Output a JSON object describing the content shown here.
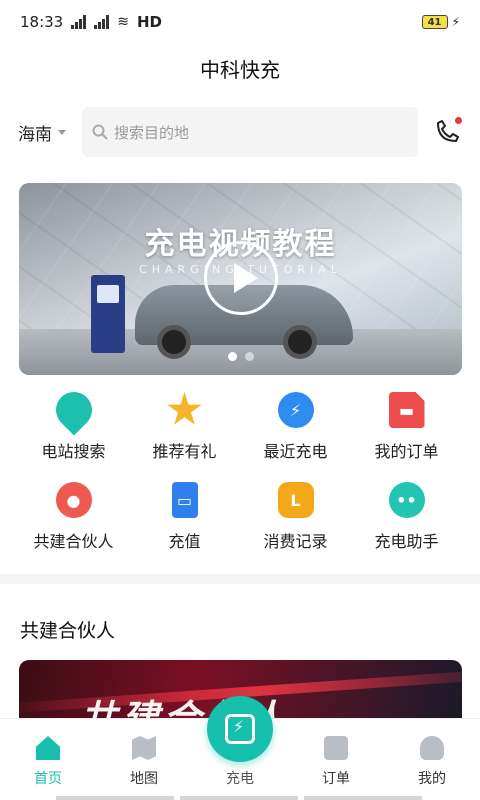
{
  "status_bar": {
    "time": "18:33",
    "network": "HD",
    "battery": "41"
  },
  "header": {
    "title": "中科快充"
  },
  "search": {
    "region": "海南",
    "placeholder": "搜索目的地"
  },
  "banner": {
    "title": "充电视频教程",
    "subtitle": "CHARGING TUTORIAL",
    "slides": 2,
    "active_slide": 1
  },
  "quick_menu": [
    {
      "label": "电站搜索",
      "icon": "location-bolt-icon"
    },
    {
      "label": "推荐有礼",
      "icon": "star-icon"
    },
    {
      "label": "最近充电",
      "icon": "recent-charge-icon"
    },
    {
      "label": "我的订单",
      "icon": "order-doc-icon"
    },
    {
      "label": "共建合伙人",
      "icon": "partner-user-icon"
    },
    {
      "label": "充值",
      "icon": "recharge-card-icon"
    },
    {
      "label": "消费记录",
      "icon": "consumption-record-icon"
    },
    {
      "label": "充电助手",
      "icon": "assistant-chat-icon"
    }
  ],
  "section": {
    "title": "共建合伙人",
    "banner_text": "共建合伙人"
  },
  "tabbar": {
    "home": "首页",
    "map": "地图",
    "charge": "充电",
    "orders": "订单",
    "me": "我的"
  },
  "colors": {
    "accent": "#17c0ac"
  }
}
